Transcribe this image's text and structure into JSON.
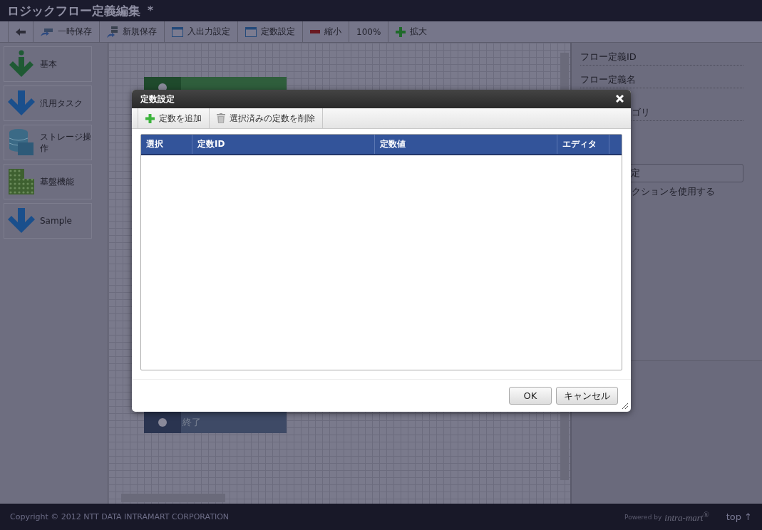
{
  "window": {
    "title": "ロジックフロー定義編集",
    "modified_mark": "*"
  },
  "toolbar": [
    {
      "kind": "back"
    },
    {
      "kind": "save",
      "label": "一時保存"
    },
    {
      "kind": "save-new",
      "label": "新規保存"
    },
    {
      "kind": "window",
      "label": "入出力設定"
    },
    {
      "kind": "window",
      "label": "定数設定"
    },
    {
      "kind": "minus",
      "label": "縮小"
    },
    {
      "kind": "text",
      "label": "100%"
    },
    {
      "kind": "plus",
      "label": "拡大"
    }
  ],
  "palette": [
    {
      "kind": "basic",
      "label": "基本"
    },
    {
      "kind": "task",
      "label": "汎用タスク"
    },
    {
      "kind": "storage",
      "label": "ストレージ操作"
    },
    {
      "kind": "platform",
      "label": "基盤機能"
    },
    {
      "kind": "task",
      "label": "Sample"
    }
  ],
  "canvas_nodes": [
    {
      "kind": "start"
    },
    {
      "kind": "end",
      "label": "終了"
    }
  ],
  "properties": [
    {
      "kind": "field",
      "label": "フロー定義ID"
    },
    {
      "kind": "field",
      "label": "フロー定義名"
    },
    {
      "kind": "field",
      "label": "ゴリ"
    },
    {
      "kind": "button",
      "label": "定"
    },
    {
      "kind": "text",
      "label": "クションを使用する"
    }
  ],
  "dialog": {
    "title": "定数設定",
    "actions": [
      {
        "kind": "add",
        "label": "定数を追加"
      },
      {
        "kind": "delete",
        "label": "選択済みの定数を削除"
      }
    ],
    "columns": [
      "選択",
      "定数ID",
      "定数値",
      "エディタ"
    ],
    "buttons": [
      "OK",
      "キャンセル"
    ]
  },
  "footer": {
    "copyright": "Copyright © 2012 NTT DATA INTRAMART CORPORATION",
    "powered_by": "Powered by",
    "brand": "intra-mart$^{®}$",
    "top_link": "top ↑"
  }
}
